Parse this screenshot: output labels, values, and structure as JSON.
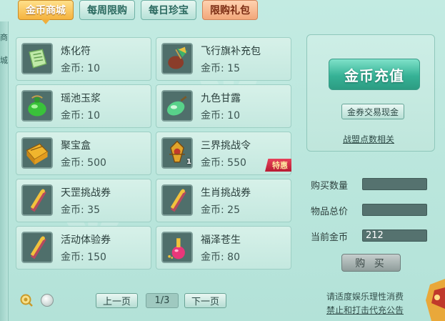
{
  "tabs": [
    {
      "label": "金币商城",
      "active": true
    },
    {
      "label": "每周限购",
      "active": false
    },
    {
      "label": "每日珍宝",
      "active": false
    },
    {
      "label": "限购礼包",
      "active": false
    }
  ],
  "left_edge_chars": [
    "商",
    "城"
  ],
  "items": [
    {
      "name": "炼化符",
      "price": "金币: 10",
      "icon": "talisman-icon"
    },
    {
      "name": "飞行旗补充包",
      "price": "金币: 15",
      "icon": "flag-pouch-icon"
    },
    {
      "name": "瑶池玉浆",
      "price": "金币: 10",
      "icon": "jade-gourd-icon"
    },
    {
      "name": "九色甘露",
      "price": "金币: 10",
      "icon": "dew-gourd-icon"
    },
    {
      "name": "聚宝盒",
      "price": "金币: 500",
      "icon": "treasure-box-icon"
    },
    {
      "name": "三界挑战令",
      "price": "金币: 550",
      "icon": "challenge-token-icon",
      "qty": "1",
      "badge": "特惠"
    },
    {
      "name": "天罡挑战券",
      "price": "金币: 35",
      "icon": "scroll-icon"
    },
    {
      "name": "生肖挑战券",
      "price": "金币: 25",
      "icon": "scroll-icon"
    },
    {
      "name": "活动体验券",
      "price": "金币: 150",
      "icon": "scroll-icon"
    },
    {
      "name": "福泽苍生",
      "price": "金币: 80",
      "icon": "potion-bottle-icon"
    }
  ],
  "panel": {
    "recharge_label": "金币充值",
    "exchange_label": "金券交易现金",
    "alliance_label": "战盟点数相关"
  },
  "purchase": {
    "quantity_label": "购买数量",
    "quantity_value": "",
    "total_label": "物品总价",
    "total_value": "",
    "current_label": "当前金币",
    "current_value": "212",
    "buy_label": "购 买"
  },
  "pager": {
    "prev_label": "上一页",
    "page_text": "1/3",
    "next_label": "下一页"
  },
  "notices": {
    "line1": "请适度娱乐理性消费",
    "line2": "禁止和打击代充公告"
  },
  "colors": {
    "active_tab": "#f5b33f",
    "recharge": "#36b296",
    "badge": "#d02a45"
  }
}
